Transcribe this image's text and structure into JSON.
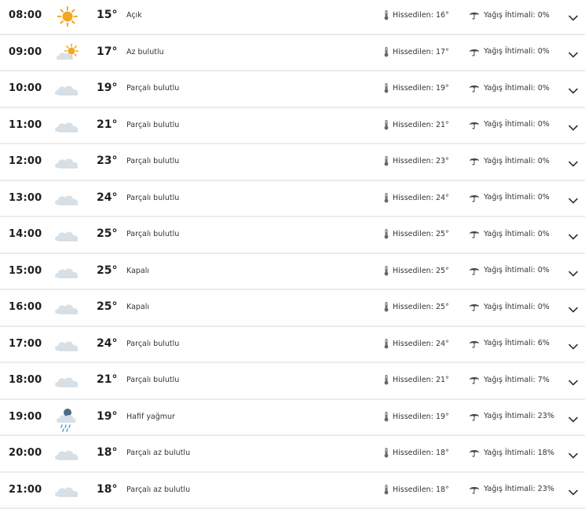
{
  "labels": {
    "feels_like": "Hissedilen:",
    "rain_chance": "Yağış İhtimali:"
  },
  "icons": {
    "thermometer": "thermometer-icon",
    "umbrella": "umbrella-icon",
    "expand": "chevron-down-icon"
  },
  "colors": {
    "sun": "#f5a623",
    "cloud": "#d7e0e6",
    "cloud_dark": "#4a6c8a",
    "rain": "#4aa3df",
    "divider": "#e9ecef"
  },
  "hours": [
    {
      "time": "08:00",
      "temp": "15°",
      "condition": "Açık",
      "icon": "sun-icon",
      "feels": "16°",
      "rain": "0%"
    },
    {
      "time": "09:00",
      "temp": "17°",
      "condition": "Az bulutlu",
      "icon": "partly-sunny-icon",
      "feels": "17°",
      "rain": "0%"
    },
    {
      "time": "10:00",
      "temp": "19°",
      "condition": "Parçalı bulutlu",
      "icon": "cloud-icon",
      "feels": "19°",
      "rain": "0%"
    },
    {
      "time": "11:00",
      "temp": "21°",
      "condition": "Parçalı bulutlu",
      "icon": "cloud-icon",
      "feels": "21°",
      "rain": "0%"
    },
    {
      "time": "12:00",
      "temp": "23°",
      "condition": "Parçalı bulutlu",
      "icon": "cloud-icon",
      "feels": "23°",
      "rain": "0%"
    },
    {
      "time": "13:00",
      "temp": "24°",
      "condition": "Parçalı bulutlu",
      "icon": "cloud-icon",
      "feels": "24°",
      "rain": "0%"
    },
    {
      "time": "14:00",
      "temp": "25°",
      "condition": "Parçalı bulutlu",
      "icon": "cloud-icon",
      "feels": "25°",
      "rain": "0%"
    },
    {
      "time": "15:00",
      "temp": "25°",
      "condition": "Kapalı",
      "icon": "cloud-icon",
      "feels": "25°",
      "rain": "0%"
    },
    {
      "time": "16:00",
      "temp": "25°",
      "condition": "Kapalı",
      "icon": "cloud-icon",
      "feels": "25°",
      "rain": "0%"
    },
    {
      "time": "17:00",
      "temp": "24°",
      "condition": "Parçalı bulutlu",
      "icon": "cloud-icon",
      "feels": "24°",
      "rain": "6%"
    },
    {
      "time": "18:00",
      "temp": "21°",
      "condition": "Parçalı bulutlu",
      "icon": "cloud-icon",
      "feels": "21°",
      "rain": "7%"
    },
    {
      "time": "19:00",
      "temp": "19°",
      "condition": "Hafif yağmur",
      "icon": "light-rain-icon",
      "feels": "19°",
      "rain": "23%"
    },
    {
      "time": "20:00",
      "temp": "18°",
      "condition": "Parçalı az bulutlu",
      "icon": "cloud-icon",
      "feels": "18°",
      "rain": "18%"
    },
    {
      "time": "21:00",
      "temp": "18°",
      "condition": "Parçalı az bulutlu",
      "icon": "cloud-icon",
      "feels": "18°",
      "rain": "23%"
    }
  ]
}
